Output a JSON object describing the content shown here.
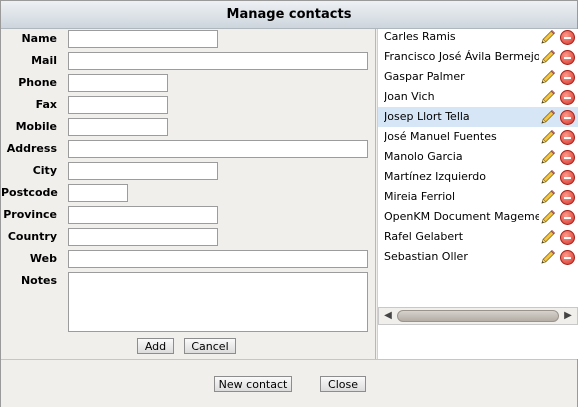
{
  "dialog": {
    "title": "Manage contacts"
  },
  "form": {
    "fields": [
      {
        "label": "Name",
        "value": ""
      },
      {
        "label": "Mail",
        "value": ""
      },
      {
        "label": "Phone",
        "value": ""
      },
      {
        "label": "Fax",
        "value": ""
      },
      {
        "label": "Mobile",
        "value": ""
      },
      {
        "label": "Address",
        "value": ""
      },
      {
        "label": "City",
        "value": ""
      },
      {
        "label": "Postcode",
        "value": ""
      },
      {
        "label": "Province",
        "value": ""
      },
      {
        "label": "Country",
        "value": ""
      },
      {
        "label": "Web",
        "value": ""
      },
      {
        "label": "Notes",
        "value": ""
      }
    ],
    "add_label": "Add",
    "cancel_label": "Cancel"
  },
  "contacts": {
    "items": [
      {
        "name": "Carles Ramis"
      },
      {
        "name": "Francisco José Ávila Bermejo"
      },
      {
        "name": "Gaspar Palmer"
      },
      {
        "name": "Joan Vich"
      },
      {
        "name": "Josep Llort Tella",
        "selected": true
      },
      {
        "name": "José Manuel Fuentes"
      },
      {
        "name": "Manolo Garcia"
      },
      {
        "name": "Martínez Izquierdo"
      },
      {
        "name": "Mireia Ferriol"
      },
      {
        "name": "OpenKM Document Magement"
      },
      {
        "name": "Rafel Gelabert"
      },
      {
        "name": "Sebastian Oller"
      }
    ],
    "edit_icon": "pencil-icon",
    "delete_icon": "delete-icon"
  },
  "footer": {
    "new_contact_label": "New contact",
    "close_label": "Close"
  },
  "colors": {
    "selected_row": "#d7e6f6",
    "titlebar": "#dfe5ea",
    "panel_bg": "#f1efec"
  }
}
